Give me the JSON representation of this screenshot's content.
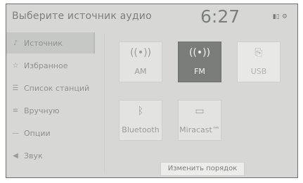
{
  "header": {
    "title": "Выберите источник аудио",
    "time": "6:27",
    "status_icons": [
      "signal-icon",
      "settings-icon"
    ]
  },
  "sidebar": {
    "items": [
      {
        "label": "Источник",
        "icon": "audio-source-icon",
        "active": true
      },
      {
        "label": "Избранное",
        "icon": "favorite-icon",
        "active": false
      },
      {
        "label": "Список станций",
        "icon": "station-list-icon",
        "active": false
      },
      {
        "label": "Вручную",
        "icon": "manual-tune-icon",
        "active": false
      },
      {
        "label": "Опции",
        "icon": "options-icon",
        "active": false
      },
      {
        "label": "Звук",
        "icon": "sound-icon",
        "active": false
      }
    ]
  },
  "sources": [
    {
      "label": "AM",
      "icon": "antenna-icon",
      "state": "normal"
    },
    {
      "label": "FM",
      "icon": "antenna-icon",
      "state": "selected"
    },
    {
      "label": "USB",
      "icon": "usb-icon",
      "state": "disabled"
    },
    {
      "label": "Bluetooth",
      "icon": "bluetooth-icon",
      "state": "normal"
    },
    {
      "label": "Miracast™",
      "icon": "miracast-icon",
      "state": "normal"
    }
  ],
  "reorder_label": "Изменить порядок",
  "colors": {
    "background": "#d7d8d6",
    "selected_tile": "#7b7d7b",
    "text": "#8f918f"
  }
}
